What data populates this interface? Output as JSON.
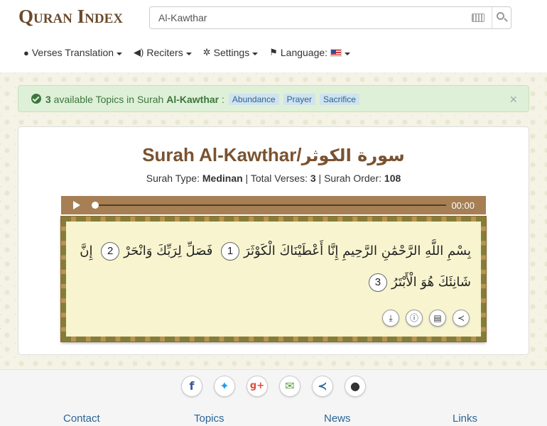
{
  "header": {
    "logo": "Quran Index",
    "search": {
      "value": "Al-Kawthar",
      "placeholder": ""
    },
    "nav": [
      {
        "label": "Verses Translation",
        "icon": "globe-icon"
      },
      {
        "label": "Reciters",
        "icon": "speaker-icon"
      },
      {
        "label": "Settings",
        "icon": "gear-icon"
      },
      {
        "label": "Language:",
        "icon": "flag-icon"
      }
    ]
  },
  "alert": {
    "count": "3",
    "text_before": " available Topics in Surah ",
    "surah": "Al-Kawthar",
    "sep": " :",
    "topics": [
      "Abundance",
      "Prayer",
      "Sacrifice"
    ],
    "close": "×"
  },
  "surah": {
    "title_en": "Surah Al-Kawthar/",
    "title_ar": "سورة الكوثر",
    "type_label": "Surah Type: ",
    "type": "Medinan",
    "verses_label": " | Total Verses: ",
    "verses": "3",
    "order_label": " | Surah Order: ",
    "order": "108"
  },
  "player": {
    "time": "00:00",
    "progress": 0
  },
  "verses": [
    {
      "text": "بِسْمِ اللَّهِ الرَّحْمَٰنِ الرَّحِيمِ إِنَّا أَعْطَيْنَاكَ الْكَوْثَرَ",
      "num": "1"
    },
    {
      "text": "فَصَلِّ لِرَبِّكَ وَانْحَرْ",
      "num": "2"
    },
    {
      "text": "إِنَّ شَانِئَكَ هُوَ الْأَبْتَرُ",
      "num": "3"
    }
  ],
  "footer": {
    "social": [
      "facebook-icon",
      "twitter-icon",
      "google-plus-icon",
      "email-icon",
      "share-icon",
      "github-icon"
    ],
    "links": [
      "Contact",
      "Topics",
      "News",
      "Links"
    ]
  },
  "colors": {
    "brand": "#6b4a2b",
    "title": "#7a5230",
    "player": "#a67f55",
    "alert_bg": "#dff0d8",
    "link": "#2a6496"
  }
}
